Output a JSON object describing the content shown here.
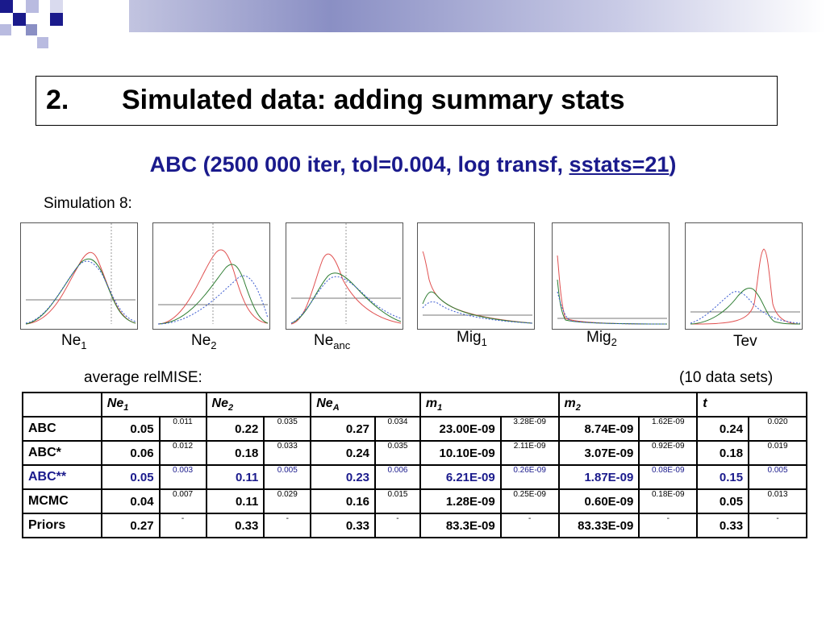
{
  "title": {
    "number": "2.",
    "text": "Simulated data: adding summary stats"
  },
  "subtitle": {
    "prefix": "ABC (2500 000 iter, tol=0.004, log transf, ",
    "link": "sstats=21",
    "suffix": ")"
  },
  "simulation_label": "Simulation 8:",
  "plots": [
    {
      "label": "Ne",
      "sub": "1"
    },
    {
      "label": "Ne",
      "sub": "2"
    },
    {
      "label": "Ne",
      "sub": "anc"
    },
    {
      "label": "Mig",
      "sub": "1"
    },
    {
      "label": "Mig",
      "sub": "2"
    },
    {
      "label": "Tev",
      "sub": ""
    }
  ],
  "avg_label": "average relMISE:",
  "datasets_label": "(10 data sets)",
  "table": {
    "headers": [
      {
        "label": "Ne",
        "sub": "1"
      },
      {
        "label": "Ne",
        "sub": "2"
      },
      {
        "label": "Ne",
        "sub": "A"
      },
      {
        "label": "m",
        "sub": "1"
      },
      {
        "label": "m",
        "sub": "2"
      },
      {
        "label": "t",
        "sub": ""
      }
    ],
    "rows": [
      {
        "label": "ABC",
        "cells": [
          [
            "0.05",
            "0.011"
          ],
          [
            "0.22",
            "0.035"
          ],
          [
            "0.27",
            "0.034"
          ],
          [
            "23.00E-09",
            "3.28E-09"
          ],
          [
            "8.74E-09",
            "1.62E-09"
          ],
          [
            "0.24",
            "0.020"
          ]
        ]
      },
      {
        "label": "ABC*",
        "cells": [
          [
            "0.06",
            "0.012"
          ],
          [
            "0.18",
            "0.033"
          ],
          [
            "0.24",
            "0.035"
          ],
          [
            "10.10E-09",
            "2.11E-09"
          ],
          [
            "3.07E-09",
            "0.92E-09"
          ],
          [
            "0.18",
            "0.019"
          ]
        ]
      },
      {
        "label": "ABC**",
        "cells": [
          [
            "0.05",
            "0.003"
          ],
          [
            "0.11",
            "0.005"
          ],
          [
            "0.23",
            "0.006"
          ],
          [
            "6.21E-09",
            "0.26E-09"
          ],
          [
            "1.87E-09",
            "0.08E-09"
          ],
          [
            "0.15",
            "0.005"
          ]
        ]
      },
      {
        "label": "MCMC",
        "cells": [
          [
            "0.04",
            "0.007"
          ],
          [
            "0.11",
            "0.029"
          ],
          [
            "0.16",
            "0.015"
          ],
          [
            "1.28E-09",
            "0.25E-09"
          ],
          [
            "0.60E-09",
            "0.18E-09"
          ],
          [
            "0.05",
            "0.013"
          ]
        ]
      },
      {
        "label": "Priors",
        "cells": [
          [
            "0.27",
            "-"
          ],
          [
            "0.33",
            "-"
          ],
          [
            "0.33",
            "-"
          ],
          [
            "83.3E-09",
            "-"
          ],
          [
            "83.33E-09",
            "-"
          ],
          [
            "0.33",
            "-"
          ]
        ]
      }
    ],
    "highlight_row": 2,
    "highlight_color": "#1a1a8c"
  },
  "colors": {
    "title_blue": "#1a1a8c",
    "curve_red": "#e05050",
    "curve_green": "#2e7d32",
    "curve_blue_dotted": "#3a5ad0",
    "prior_gray": "#777777"
  }
}
